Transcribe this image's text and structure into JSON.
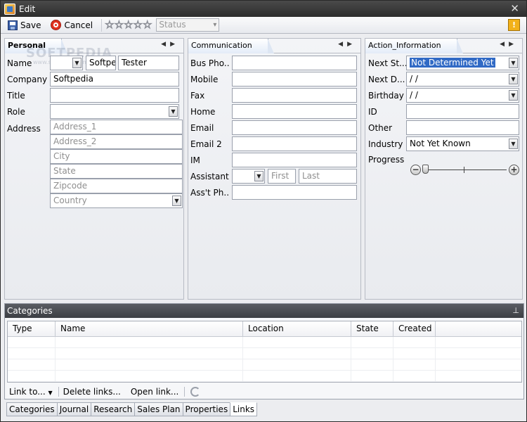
{
  "window": {
    "title": "Edit",
    "close_glyph": "✕"
  },
  "toolbar": {
    "save_label": "Save",
    "cancel_label": "Cancel",
    "stars": [
      "☆",
      "☆",
      "☆",
      "☆",
      "☆"
    ],
    "status_value": "Status",
    "warning_glyph": "!"
  },
  "panels": {
    "personal": {
      "tab": "Personal",
      "watermark": "SOFTPEDIA",
      "watermark_small": "www.softpedia.com",
      "labels": {
        "name": "Name",
        "company": "Company",
        "title": "Title",
        "role": "Role",
        "address": "Address"
      },
      "name_first": "Softpe",
      "name_last": "Tester",
      "company_value": "Softpedia",
      "address": {
        "line1": "Address_1",
        "line2": "Address_2",
        "city": "City",
        "state": "State",
        "zipcode": "Zipcode",
        "country": "Country"
      }
    },
    "communication": {
      "tab": "Communication",
      "labels": {
        "bus_phone": "Bus Pho...",
        "mobile": "Mobile",
        "fax": "Fax",
        "home": "Home",
        "email": "Email",
        "email2": "Email 2",
        "im": "IM",
        "assistant": "Assistant",
        "asst_phone": "Ass't Ph..."
      },
      "assistant_first": "First",
      "assistant_last": "Last"
    },
    "action": {
      "tab": "Action_Information",
      "labels": {
        "next_status": "Next St...",
        "next_date": "Next D...",
        "birthday": "Birthday",
        "id": "ID",
        "other": "Other",
        "industry": "Industry",
        "progress": "Progress"
      },
      "next_status_value": "Not Determined Yet",
      "next_date_value": " / /",
      "birthday_value": " / /",
      "industry_value": "Not Yet Known",
      "progress_fraction": 0.0
    }
  },
  "categories": {
    "title": "Categories",
    "pin_glyph": "⊥",
    "columns": [
      "Type",
      "Name",
      "Location",
      "State",
      "Created"
    ],
    "actions": {
      "link_to": "Link to...",
      "delete_links": "Delete links...",
      "open_link": "Open link..."
    }
  },
  "bottom_tabs": [
    "Categories",
    "Journal",
    "Research",
    "Sales Plan",
    "Properties",
    "Links"
  ]
}
